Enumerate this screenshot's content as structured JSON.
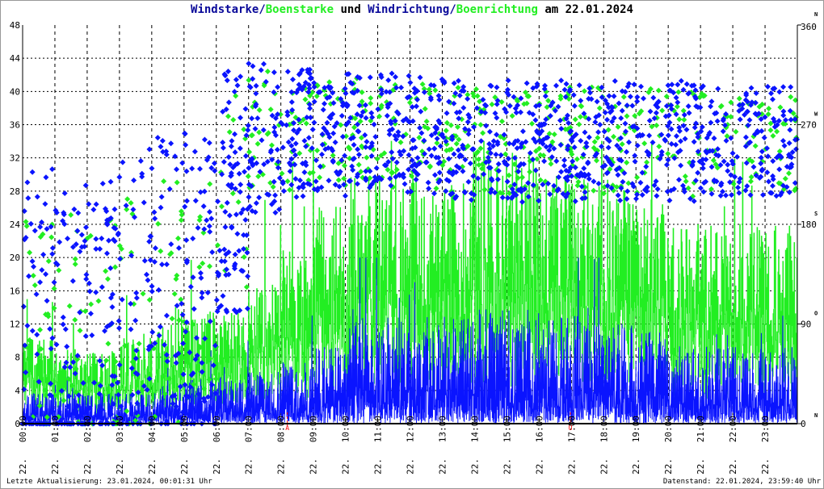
{
  "title": {
    "part1": "Windstarke",
    "sep1": "/",
    "part2": "Boenstarke",
    "part3": " und ",
    "part4": "Windrichtung",
    "sep2": "/",
    "part5": "Boenrichtung",
    "part6": " am 22.01.2024"
  },
  "footer": {
    "left": "Letzte Aktualisierung: 23.01.2024, 00:01:31 Uhr",
    "right": "Datenstand: 22.01.2024, 23:59:40 Uhr"
  },
  "colors": {
    "wind": "#0a14ff",
    "gust": "#22ee22",
    "title_blue": "#0a0a9a",
    "marker": "#ff0000"
  },
  "chart_data": {
    "type": "line",
    "title": "Windstarke/Boenstarke und Windrichtung/Boenrichtung am 22.01.2024",
    "x_ticks": [
      "22. 00:00",
      "22. 01:00",
      "22. 02:00",
      "22. 03:00",
      "22. 04:00",
      "22. 05:00",
      "22. 06:00",
      "22. 07:00",
      "22. 08:00",
      "22. 09:00",
      "22. 10:00",
      "22. 11:00",
      "22. 12:00",
      "22. 13:00",
      "22. 14:00",
      "22. 15:00",
      "22. 16:00",
      "22. 17:00",
      "22. 18:00",
      "22. 19:00",
      "22. 20:00",
      "22. 21:00",
      "22. 22:00",
      "22. 23:00"
    ],
    "xlim_hours": [
      0,
      24
    ],
    "y_left": {
      "ylim": [
        0,
        48
      ],
      "ticks": [
        0,
        4,
        8,
        12,
        16,
        20,
        24,
        28,
        32,
        36,
        40,
        44,
        48
      ]
    },
    "y_right": {
      "ylim": [
        0,
        360
      ],
      "ticks": [
        0,
        90,
        180,
        270,
        360
      ],
      "compass": [
        "N",
        "O",
        "S",
        "W",
        "N"
      ]
    },
    "grid": true,
    "markers": [
      {
        "label": "A",
        "hour": 8.2
      },
      {
        "label": "U",
        "hour": 16.97
      }
    ],
    "series": [
      {
        "name": "Windstarke",
        "style": "line",
        "hourly_mean": [
          2,
          2,
          2,
          2,
          2.5,
          3,
          3,
          3.5,
          4,
          5,
          7,
          7,
          7,
          7,
          7.5,
          7.5,
          7,
          7,
          6.5,
          6,
          5,
          5,
          5,
          5
        ]
      },
      {
        "name": "Boenstarke",
        "style": "line",
        "hourly_mean": [
          7,
          6,
          6,
          7,
          8,
          9,
          9,
          12,
          14,
          18,
          20,
          20,
          20,
          20,
          22,
          22,
          20,
          20,
          19,
          18,
          16,
          16,
          16,
          16
        ]
      },
      {
        "name": "Windrichtung",
        "style": "scatter",
        "hourly_center_deg": [
          70,
          70,
          70,
          90,
          110,
          130,
          210,
          260,
          260,
          260,
          262,
          262,
          260,
          255,
          255,
          255,
          255,
          255,
          255,
          255,
          255,
          255,
          255,
          255
        ],
        "hourly_spread_deg": [
          160,
          160,
          160,
          160,
          150,
          140,
          110,
          70,
          60,
          55,
          55,
          55,
          55,
          55,
          55,
          55,
          55,
          55,
          55,
          55,
          55,
          50,
          50,
          50
        ]
      },
      {
        "name": "Boenrichtung",
        "style": "scatter",
        "hourly_center_deg": [
          70,
          70,
          70,
          90,
          110,
          130,
          210,
          260,
          260,
          260,
          262,
          262,
          260,
          255,
          255,
          255,
          255,
          255,
          255,
          255,
          255,
          255,
          255,
          255
        ],
        "hourly_spread_deg": [
          120,
          120,
          120,
          120,
          110,
          100,
          90,
          60,
          50,
          50,
          50,
          50,
          50,
          50,
          50,
          50,
          50,
          50,
          50,
          50,
          50,
          45,
          45,
          45
        ]
      }
    ]
  }
}
